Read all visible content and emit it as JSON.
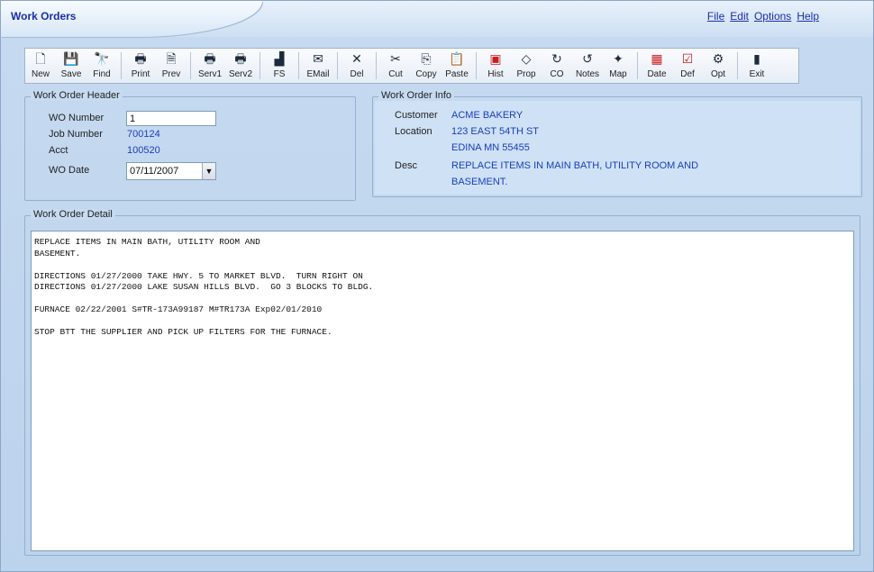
{
  "window": {
    "title": "Work Orders"
  },
  "menu": [
    "File",
    "Edit",
    "Options",
    "Help"
  ],
  "toolbar": [
    {
      "icon": "new-icon",
      "glyph": "🗋",
      "label": "New"
    },
    {
      "icon": "save-icon",
      "glyph": "💾",
      "label": "Save"
    },
    {
      "icon": "find-icon",
      "glyph": "🔭",
      "label": "Find"
    },
    {
      "sep": true
    },
    {
      "icon": "print-icon",
      "glyph": "🖶",
      "label": "Print"
    },
    {
      "icon": "preview-icon",
      "glyph": "🗎",
      "label": "Prev"
    },
    {
      "sep": true
    },
    {
      "icon": "serv1-icon",
      "glyph": "🖶",
      "label": "Serv1"
    },
    {
      "icon": "serv2-icon",
      "glyph": "🖶",
      "label": "Serv2"
    },
    {
      "sep": true
    },
    {
      "icon": "fs-icon",
      "glyph": "▟",
      "label": "FS"
    },
    {
      "sep": true
    },
    {
      "icon": "email-icon",
      "glyph": "✉",
      "label": "EMail"
    },
    {
      "sep": true
    },
    {
      "icon": "delete-icon",
      "glyph": "✕",
      "label": "Del"
    },
    {
      "sep": true
    },
    {
      "icon": "cut-icon",
      "glyph": "✂",
      "label": "Cut"
    },
    {
      "icon": "copy-icon",
      "glyph": "⎘",
      "label": "Copy"
    },
    {
      "icon": "paste-icon",
      "glyph": "📋",
      "label": "Paste"
    },
    {
      "sep": true
    },
    {
      "icon": "history-icon",
      "glyph": "▣",
      "label": "Hist",
      "color": "red"
    },
    {
      "icon": "properties-icon",
      "glyph": "◇",
      "label": "Prop"
    },
    {
      "icon": "change-order-icon",
      "glyph": "↻",
      "label": "CO"
    },
    {
      "icon": "notes-icon",
      "glyph": "↺",
      "label": "Notes"
    },
    {
      "icon": "map-icon",
      "glyph": "✦",
      "label": "Map"
    },
    {
      "sep": true
    },
    {
      "icon": "date-icon",
      "glyph": "▦",
      "label": "Date",
      "color": "red"
    },
    {
      "icon": "default-icon",
      "glyph": "☑",
      "label": "Def",
      "color": "red"
    },
    {
      "icon": "options-icon",
      "glyph": "⚙",
      "label": "Opt"
    },
    {
      "sep": true
    },
    {
      "icon": "exit-icon",
      "glyph": "▮",
      "label": "Exit"
    }
  ],
  "header": {
    "title": "Work Order Header",
    "wo_number_label": "WO Number",
    "wo_number_value": "1",
    "job_number_label": "Job Number",
    "job_number_value": "700124",
    "acct_label": "Acct",
    "acct_value": "100520",
    "wo_date_label": "WO Date",
    "wo_date_value": "07/11/2007"
  },
  "info": {
    "title": "Work Order Info",
    "customer_label": "Customer",
    "customer_value": "ACME BAKERY",
    "location_label": "Location",
    "location_line1": "123 EAST 54TH ST",
    "location_line2": "EDINA  MN  55455",
    "desc_label": "Desc",
    "desc_line1": "REPLACE ITEMS IN MAIN BATH, UTILITY ROOM AND",
    "desc_line2": "BASEMENT."
  },
  "detail": {
    "title": "Work Order Detail",
    "lines": [
      "REPLACE ITEMS IN MAIN BATH, UTILITY ROOM AND",
      "BASEMENT.",
      "",
      "DIRECTIONS 01/27/2000 TAKE HWY. 5 TO MARKET BLVD.  TURN RIGHT ON",
      "DIRECTIONS 01/27/2000 LAKE SUSAN HILLS BLVD.  GO 3 BLOCKS TO BLDG.",
      "",
      "FURNACE 02/22/2001 S#TR-173A99187 M#TR173A Exp02/01/2010",
      "",
      "STOP BTT THE SUPPLIER AND PICK UP FILTERS FOR THE FURNACE."
    ]
  },
  "colors": {
    "accent": "#1a2faa",
    "value_text": "#1a3dc0",
    "background": "#c6daf0"
  }
}
